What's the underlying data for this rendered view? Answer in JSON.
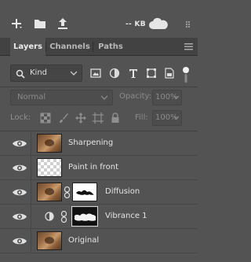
{
  "toolbar": {
    "size_label": "-- KB"
  },
  "tabs": [
    {
      "label": "Layers",
      "active": true
    },
    {
      "label": "Channels",
      "active": false
    },
    {
      "label": "Paths",
      "active": false
    }
  ],
  "filter": {
    "kind_label": "Kind"
  },
  "blend": {
    "mode": "Normal",
    "opacity_label": "Opacity:",
    "opacity_value": "100%"
  },
  "lock": {
    "label": "Lock:",
    "fill_label": "Fill:",
    "fill_value": "100%"
  },
  "layers": [
    {
      "name": "Sharpening",
      "thumbnail": "photo",
      "visible": true
    },
    {
      "name": "Paint in front",
      "thumbnail": "transparent",
      "visible": true
    },
    {
      "name": "Diffusion",
      "thumbnail": "photo",
      "has_mask": true,
      "visible": true
    },
    {
      "name": "Vibrance 1",
      "thumbnail": "adjustment",
      "has_mask": true,
      "clipped": true,
      "visible": true
    },
    {
      "name": "Original",
      "thumbnail": "photo",
      "visible": true
    }
  ],
  "colors": {
    "panel_bg": "#535353",
    "tab_bar_bg": "#424242",
    "text": "#e4e4e4"
  }
}
